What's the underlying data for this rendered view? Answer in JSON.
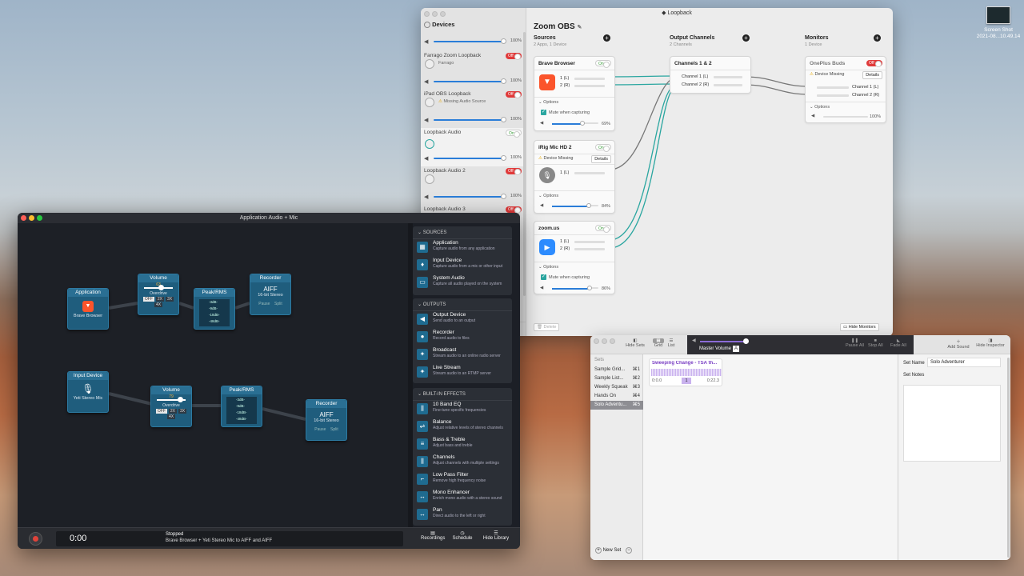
{
  "desktop": {
    "icon_name": "Screen Shot",
    "icon_date": "2021-08...10.49.14"
  },
  "loopback": {
    "title": "Loopback",
    "devices_header": "Devices",
    "devices": [
      {
        "name": "",
        "sub": "",
        "switch": "",
        "volume": "100%"
      },
      {
        "name": "Farrago Zoom Loopback",
        "sub": "Farrago",
        "switch": "Off",
        "volume": "100%"
      },
      {
        "name": "iPad OBS Loopback",
        "sub": "Missing Audio Source",
        "switch": "Off",
        "volume": "100%"
      },
      {
        "name": "Loopback Audio",
        "sub": "",
        "switch": "On",
        "volume": "100%"
      },
      {
        "name": "Loopback Audio 2",
        "sub": "",
        "switch": "Off",
        "volume": "100%"
      },
      {
        "name": "Loopback Audio 3",
        "sub": "",
        "switch": "Off",
        "volume": ""
      }
    ],
    "device_name": "Zoom OBS",
    "sources_header": "Sources",
    "sources_sub": "2 Apps, 1 Device",
    "outputs_header": "Output Channels",
    "outputs_sub": "2 Channels",
    "monitors_header": "Monitors",
    "monitors_sub": "1 Device",
    "sources": [
      {
        "name": "Brave Browser",
        "switch": "On",
        "ch1": "1 (L)",
        "ch2": "2 (R)",
        "options": "Options",
        "mute": "Mute when capturing",
        "volume": "69%"
      },
      {
        "name": "iRig Mic HD 2",
        "switch": "On",
        "warning": "Device Missing",
        "details": "Details",
        "ch1": "1 (L)",
        "options": "Options",
        "volume": "84%"
      },
      {
        "name": "zoom.us",
        "switch": "On",
        "ch1": "1 (L)",
        "ch2": "2 (R)",
        "options": "Options",
        "mute": "Mute when capturing",
        "volume": "86%"
      }
    ],
    "output": {
      "name": "Channels 1 & 2",
      "ch1": "Channel 1 (L)",
      "ch2": "Channel 2 (R)"
    },
    "monitor": {
      "name": "OnePlus Buds",
      "switch": "Off",
      "warning": "Device Missing",
      "details": "Details",
      "ch1": "Channel 1 (L)",
      "ch2": "Channel 2 (R)",
      "options": "Options",
      "volume": "100%"
    },
    "delete_label": "Delete",
    "hide_monitors_label": "Hide Monitors"
  },
  "hijack": {
    "title": "Application Audio + Mic",
    "row1": {
      "app_title": "Application",
      "app_sub": "Brave Browser",
      "vol_title": "Volume",
      "vol_value": "63",
      "overdrive": "Overdrive",
      "seg": [
        "OFF",
        "2X",
        "3X",
        "4X"
      ],
      "peak_title": "Peak/RMS",
      "meter": [
        "-3dB-",
        "-9dB-",
        "-18dB-",
        "-48dB-"
      ],
      "rec_title": "Recorder",
      "rec_format": "AIFF",
      "rec_sub": "16-bit Stereo",
      "pause": "Pause",
      "split": "Split"
    },
    "row2": {
      "in_title": "Input Device",
      "in_sub": "Yeti Stereo Mic",
      "vol_title": "Volume",
      "vol_value": "79",
      "overdrive": "Overdrive",
      "seg": [
        "OFF",
        "2X",
        "3X",
        "4X"
      ],
      "peak_title": "Peak/RMS",
      "meter": [
        "-3dB-",
        "-9dB-",
        "-18dB-",
        "-48dB-"
      ],
      "rec_title": "Recorder",
      "rec_format": "AIFF",
      "rec_sub": "16-bit Stereo",
      "pause": "Pause",
      "split": "Split"
    },
    "library": {
      "sources_header": "SOURCES",
      "sources": [
        {
          "title": "Application",
          "desc": "Capture audio from any application"
        },
        {
          "title": "Input Device",
          "desc": "Capture audio from a mic or other input"
        },
        {
          "title": "System Audio",
          "desc": "Capture all audio played on the system"
        }
      ],
      "outputs_header": "OUTPUTS",
      "outputs": [
        {
          "title": "Output Device",
          "desc": "Send audio to an output"
        },
        {
          "title": "Recorder",
          "desc": "Record audio to files"
        },
        {
          "title": "Broadcast",
          "desc": "Stream audio to an online radio server"
        },
        {
          "title": "Live Stream",
          "desc": "Stream audio to an RTMP server"
        }
      ],
      "effects_header": "BUILT-IN EFFECTS",
      "effects": [
        {
          "title": "10 Band EQ",
          "desc": "Fine-tune specific frequencies"
        },
        {
          "title": "Balance",
          "desc": "Adjust relative levels of stereo channels"
        },
        {
          "title": "Bass & Treble",
          "desc": "Adjust bass and treble"
        },
        {
          "title": "Channels",
          "desc": "Adjust channels with multiple settings"
        },
        {
          "title": "Low Pass Filter",
          "desc": "Remove high frequency noise"
        },
        {
          "title": "Mono Enhancer",
          "desc": "Enrich mono audio with a stereo sound"
        },
        {
          "title": "Pan",
          "desc": "Direct audio to the left or right"
        }
      ]
    },
    "time": "0:00",
    "status": "Stopped",
    "status_detail": "Brave Browser + Yeti Stereo Mic to AIFF and AIFF",
    "recordings": "Recordings",
    "schedule": "Schedule",
    "hide_library": "Hide Library"
  },
  "farrago": {
    "hide_sets": "Hide Sets",
    "grid": "Grid",
    "list": "List",
    "master_volume": "Master Volume",
    "pause_all": "Pause All",
    "stop_all": "Stop All",
    "fade_all": "Fade All",
    "add_sound": "Add Sound",
    "hide_inspector": "Hide Inspector",
    "sets_header": "Sets",
    "sets": [
      {
        "name": "Sample Grid...",
        "key": "⌘1"
      },
      {
        "name": "Sample List...",
        "key": "⌘2"
      },
      {
        "name": "Weekly Squeak",
        "key": "⌘3"
      },
      {
        "name": "Hands On",
        "key": "⌘4"
      },
      {
        "name": "Solo Adventu...",
        "key": "⌘5"
      }
    ],
    "tile": {
      "title": "Sweeping Change - TSA th...",
      "start": "0:0.0",
      "num": "1",
      "end": "0:22.3"
    },
    "new_set": "New Set",
    "set_name_label": "Set Name",
    "set_name_value": "Solo Adventurer",
    "set_notes_label": "Set Notes"
  },
  "colors": {
    "accent": "#2a7dd8",
    "teal": "#2aa6a0",
    "off_red": "#e03a3a",
    "hijack_blue": "#1f5d7d",
    "farrago_purple": "#9b5fd0"
  }
}
